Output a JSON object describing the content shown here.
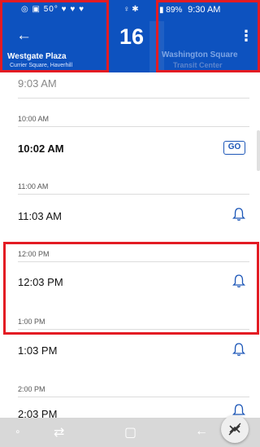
{
  "status_bar": {
    "left_icons": "◎ ▣ 50° ♥ ♥ ♥",
    "mid_icons": "♀ ✱",
    "battery": "89%",
    "time": "9:30 AM"
  },
  "header": {
    "back_icon": "←",
    "origin_name": "Westgate Plaza",
    "origin_sub": "Currier Square, Haverhill",
    "route_number": "16",
    "dest_name": "Washington Square",
    "dest_sub": "Transit Center",
    "menu_icon": "⋮"
  },
  "schedule": [
    {
      "hour": "",
      "time": "9:03 AM",
      "style": "faint"
    },
    {
      "hour": "10:00 AM",
      "time": "10:02 AM",
      "action": "GO",
      "style": "bold"
    },
    {
      "hour": "11:00 AM",
      "time": "11:03 AM",
      "action": "bell"
    },
    {
      "hour": "12:00 PM",
      "time": "12:03 PM",
      "action": "bell"
    },
    {
      "hour": "1:00 PM",
      "time": "1:03 PM",
      "action": "bell"
    },
    {
      "hour": "2:00 PM",
      "time": "2:03 PM",
      "action": "bell"
    }
  ],
  "nav": {
    "recent": "∘",
    "back_alt": "⇄",
    "home": "▢",
    "back": "←"
  },
  "colors": {
    "header_blue": "#0d52bf",
    "highlight_red": "#e31b23",
    "go_blue": "#1d57b8"
  }
}
